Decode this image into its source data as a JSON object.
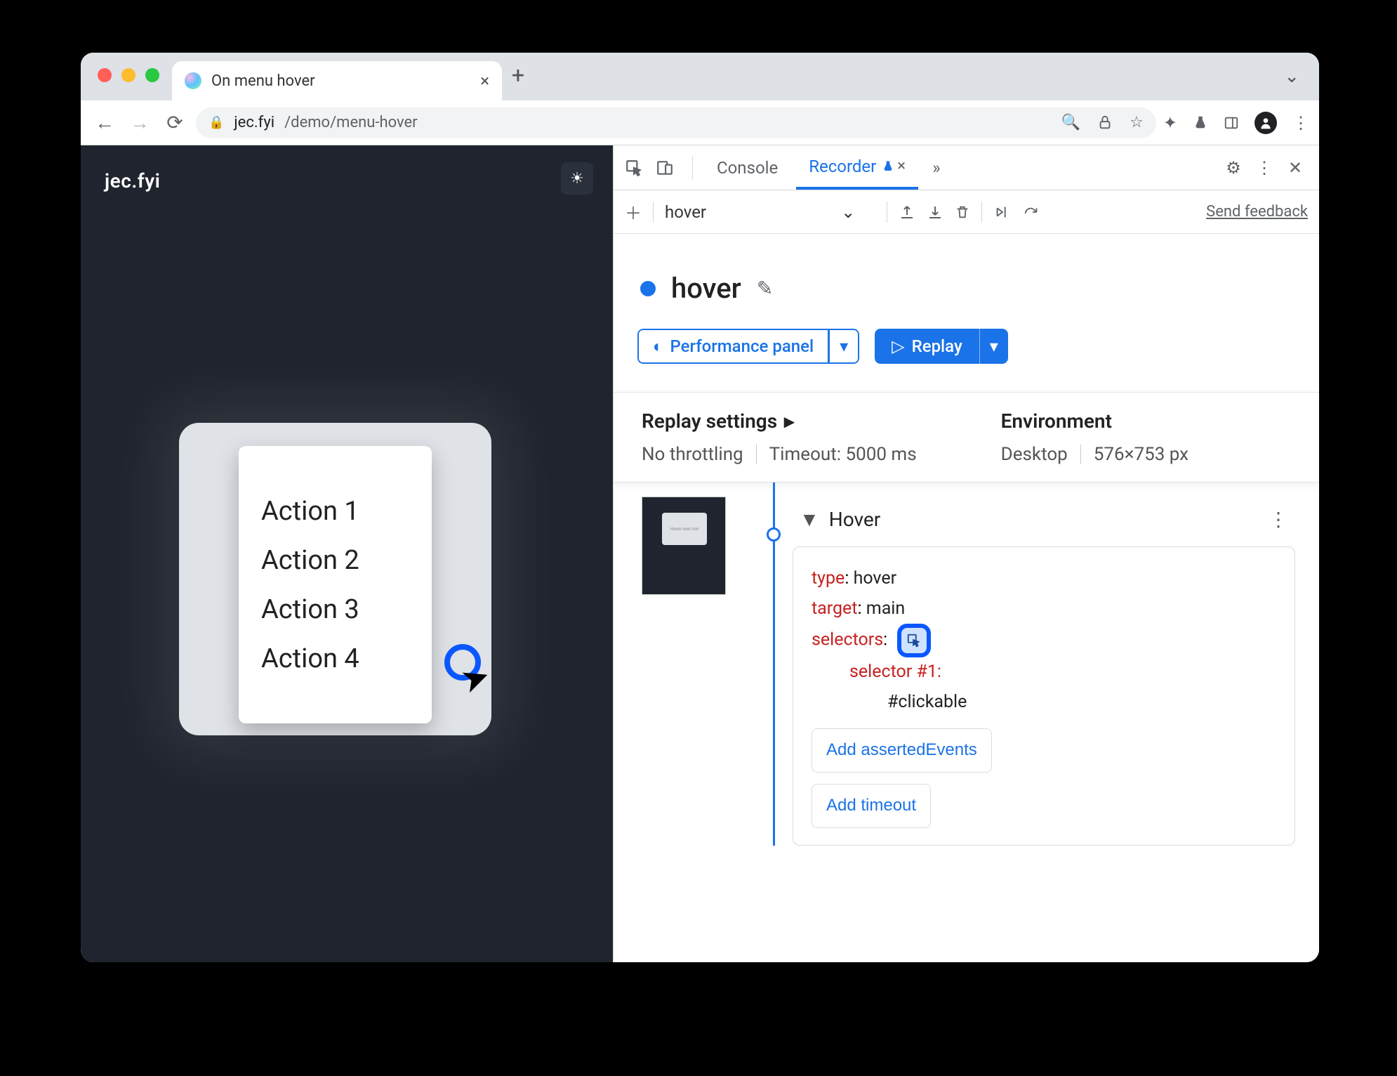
{
  "browser": {
    "tab_title": "On menu hover",
    "url_host": "jec.fyi",
    "url_path": "/demo/menu-hover"
  },
  "page": {
    "brand": "jec.fyi",
    "card_text": "Hover over me!",
    "menu_items": [
      "Action 1",
      "Action 2",
      "Action 3",
      "Action 4"
    ]
  },
  "devtools": {
    "tabs": {
      "console": "Console",
      "recorder": "Recorder"
    },
    "toolbar": {
      "recording_name": "hover",
      "feedback": "Send feedback"
    },
    "title": "hover",
    "perf_btn": "Performance panel",
    "replay_btn": "Replay",
    "settings": {
      "replay_header": "Replay settings",
      "throttling": "No throttling",
      "timeout": "Timeout: 5000 ms",
      "env_header": "Environment",
      "device": "Desktop",
      "viewport": "576×753 px"
    },
    "step": {
      "name": "Hover",
      "type_k": "type",
      "type_v": "hover",
      "target_k": "target",
      "target_v": "main",
      "selectors_k": "selectors",
      "selector1_k": "selector #1",
      "selector1_v": "#clickable",
      "add_asserted": "Add assertedEvents",
      "add_timeout": "Add timeout"
    },
    "thumb_text": "Hover over me!"
  }
}
